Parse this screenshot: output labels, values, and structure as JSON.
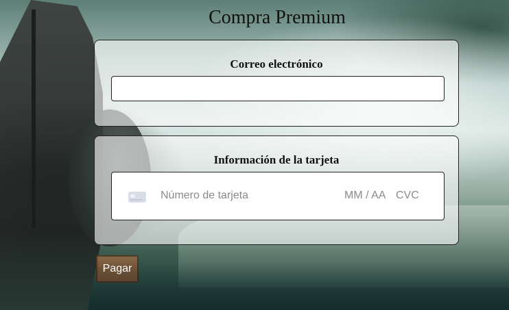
{
  "page": {
    "title": "Compra Premium"
  },
  "email": {
    "label": "Correo electrónico",
    "value": "",
    "placeholder": ""
  },
  "card": {
    "label": "Información de la tarjeta",
    "icon": "credit-card-icon",
    "number_placeholder": "Número de tarjeta",
    "expiry_placeholder": "MM / AA",
    "cvc_placeholder": "CVC"
  },
  "actions": {
    "pay_label": "Pagar"
  },
  "colors": {
    "panel_bg": "rgba(255,255,255,0.6)",
    "button_bg": "#6e5137",
    "placeholder_text": "#8a8a8a"
  }
}
